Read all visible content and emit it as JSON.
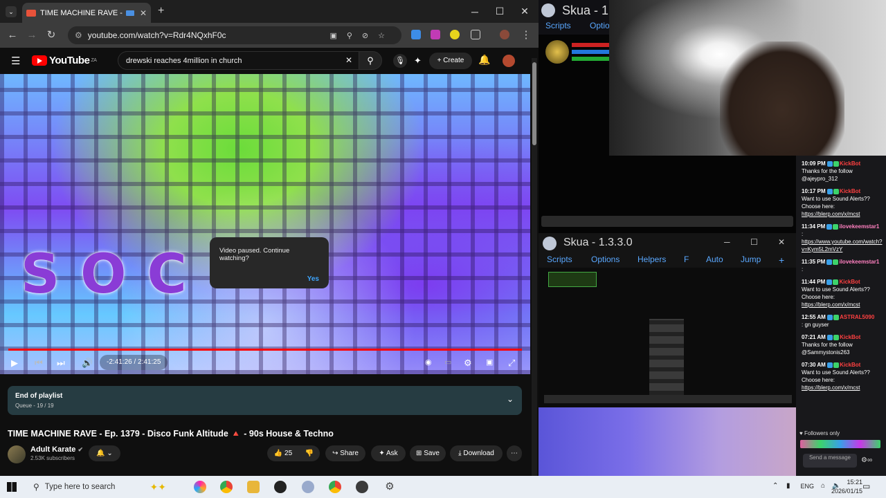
{
  "browser": {
    "tab_title": "TIME MACHINE RAVE - Ep.",
    "url": "youtube.com/watch?v=Rdr4NQxhF0c"
  },
  "youtube": {
    "logo": "YouTube",
    "region": "ZA",
    "search_value": "drewski reaches 4million in church",
    "create_label": "Create",
    "dialog_text": "Video paused. Continue watching?",
    "dialog_yes": "Yes",
    "video_overlay_text": "SOC",
    "time_display": "-2:41:26 / 2:41:25",
    "progress_fraction": 1.0,
    "playlist_title": "End of playlist",
    "playlist_queue": "Queue - 19 / 19",
    "video_title": "TIME MACHINE RAVE - Ep. 1379 - Disco Funk Altitude 🔺 - 90s House & Techno",
    "channel_name": "Adult Karate",
    "subscribers": "2.53K subscribers",
    "likes": "25",
    "share": "Share",
    "ask": "Ask",
    "save": "Save",
    "download": "Download"
  },
  "skua": {
    "top_title": "Skua - 1",
    "top_menu": [
      "Scripts",
      "Optio"
    ],
    "title": "Skua - 1.3.3.0",
    "menu": [
      "Scripts",
      "Options",
      "Helpers",
      "F",
      "Auto",
      "Jump",
      "+"
    ]
  },
  "chat": {
    "messages": [
      {
        "time": "10:09 PM",
        "user": "KickBot",
        "user_color": "#ff4040",
        "text": "Thanks for the follow @ajeypro_312"
      },
      {
        "time": "10:17 PM",
        "user": "KickBot",
        "user_color": "#ff4040",
        "text": "Want to use Sound Alerts?? Choose here:",
        "link": "https://blerp.com/x/mcst"
      },
      {
        "time": "11:34 PM",
        "user": "ilovekeemstar1",
        "user_color": "#ff80c0",
        "text": ":",
        "link": "https://www.youtube.com/watch?v=Kym5L2mVzY"
      },
      {
        "time": "11:35 PM",
        "user": "ilovekeemstar1",
        "user_color": "#ff80c0",
        "text": ":"
      },
      {
        "time": "11:44 PM",
        "user": "KickBot",
        "user_color": "#ff4040",
        "text": "Want to use Sound Alerts?? Choose here:",
        "link": "https://blerp.com/x/mcst"
      },
      {
        "time": "12:55 AM",
        "user": "ASTRAL5090",
        "user_color": "#ff4040",
        "text": ": gn guyser"
      },
      {
        "time": "07:21 AM",
        "user": "KickBot",
        "user_color": "#ff4040",
        "text": "Thanks for the follow @Sammystonis263"
      },
      {
        "time": "07:30 AM",
        "user": "KickBot",
        "user_color": "#ff4040",
        "text": "Want to use Sound Alerts?? Choose here:",
        "link": "https://blerp.com/x/mcst"
      }
    ],
    "followers_only": "Followers only",
    "send_placeholder": "Send a message"
  },
  "taskbar": {
    "search_placeholder": "Type here to search",
    "language": "ENG",
    "time": "15:21",
    "date": "2026/01/15"
  }
}
